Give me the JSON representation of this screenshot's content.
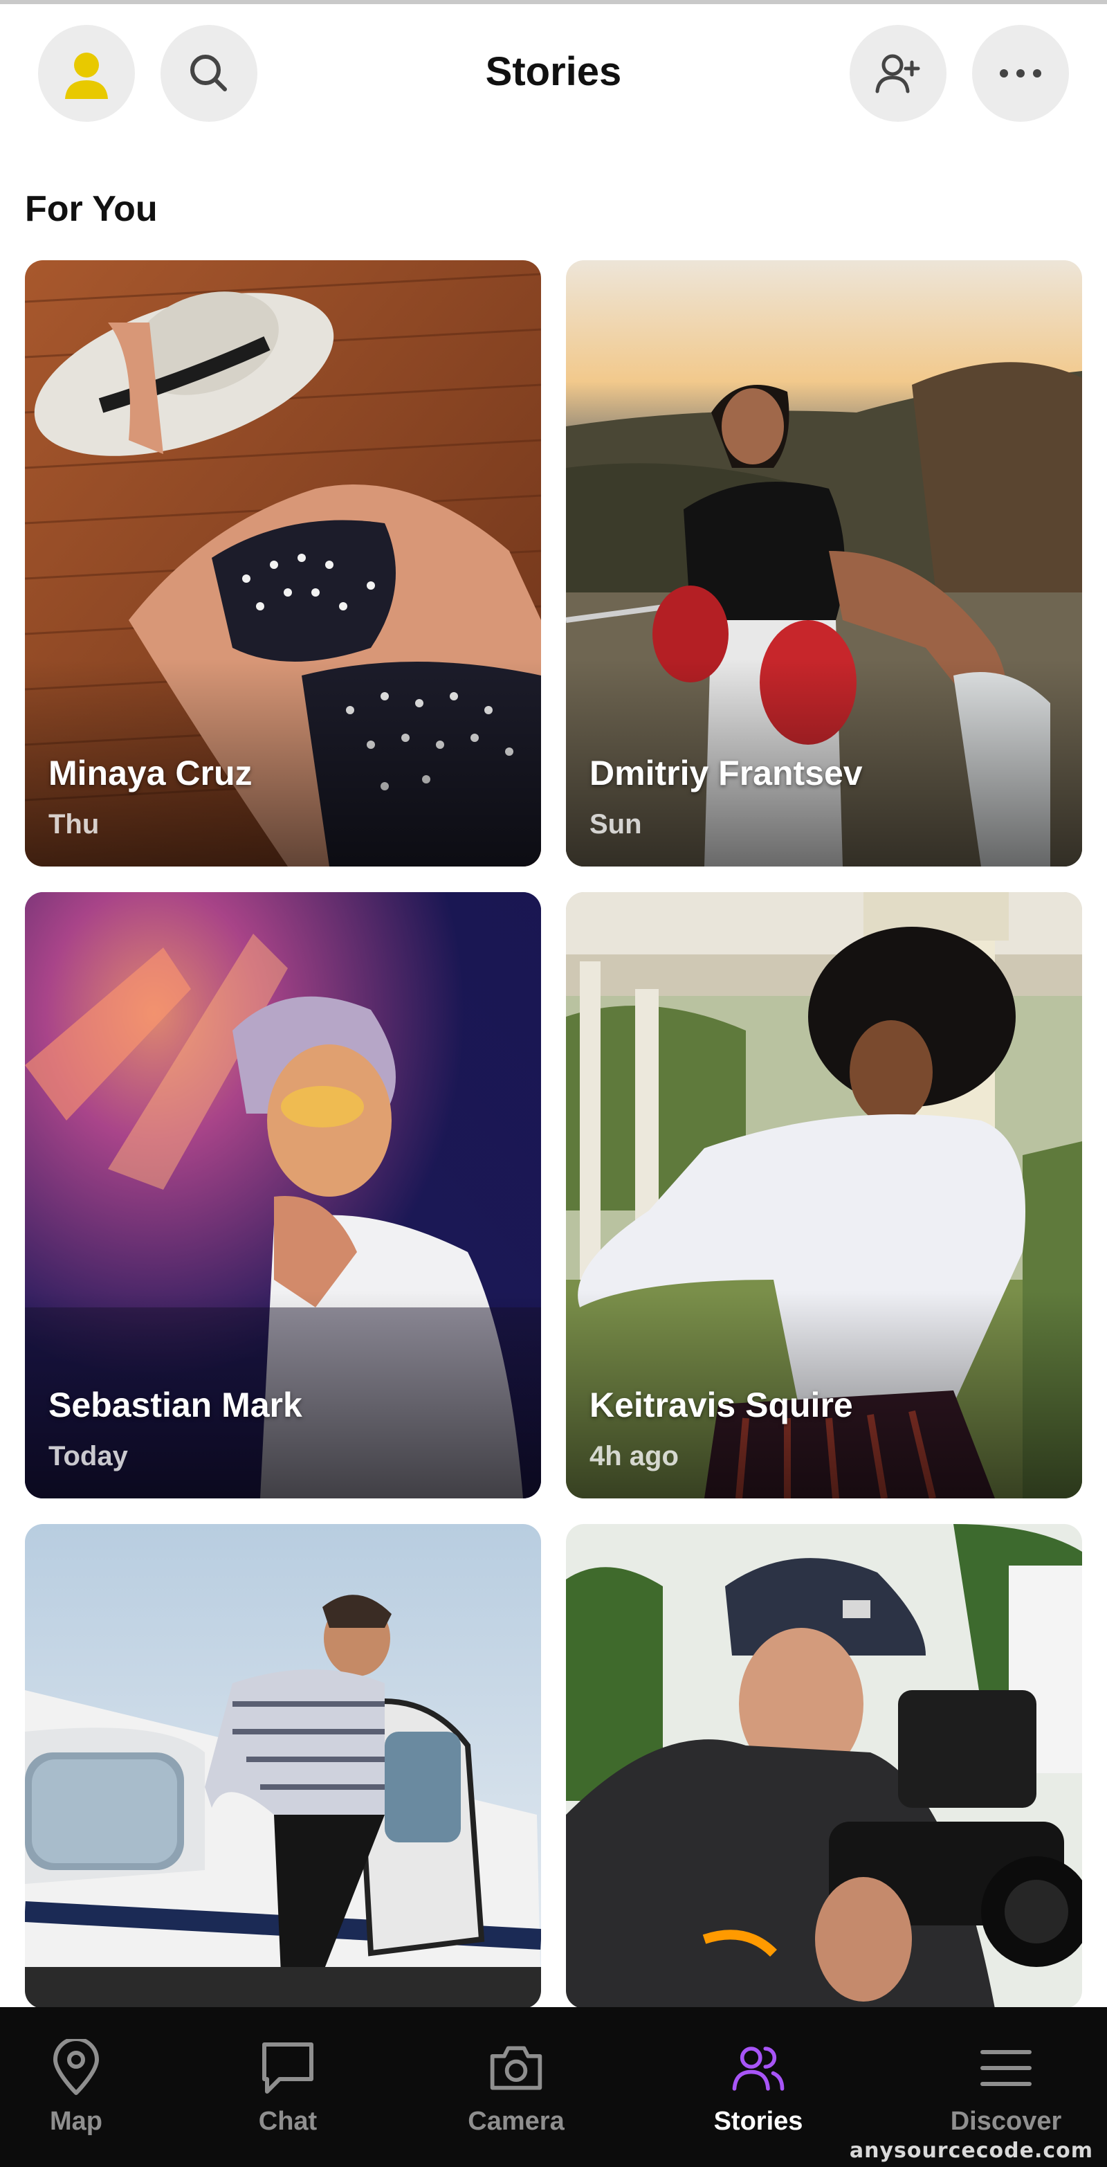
{
  "header": {
    "title": "Stories",
    "icons": [
      "avatar-icon",
      "search-icon",
      "add-friend-icon",
      "more-icon"
    ]
  },
  "section": {
    "title": "For You"
  },
  "stories": [
    {
      "name": "Minaya Cruz",
      "time": "Thu"
    },
    {
      "name": "Dmitriy Frantsev",
      "time": "Sun"
    },
    {
      "name": "Sebastian Mark",
      "time": "Today"
    },
    {
      "name": "Keitravis Squire",
      "time": "4h ago"
    },
    {
      "name": "",
      "time": ""
    },
    {
      "name": "",
      "time": ""
    }
  ],
  "tabbar": {
    "items": [
      {
        "label": "Map",
        "icon": "map-pin-icon"
      },
      {
        "label": "Chat",
        "icon": "chat-icon"
      },
      {
        "label": "Camera",
        "icon": "camera-icon"
      },
      {
        "label": "Stories",
        "icon": "stories-icon",
        "active": true
      },
      {
        "label": "Discover",
        "icon": "menu-icon"
      }
    ],
    "active_color": "#a855f7"
  },
  "colors": {
    "avatar": "#e8c900",
    "active_tab_icon": "#a855f7"
  },
  "watermark": "anysourcecode.com"
}
